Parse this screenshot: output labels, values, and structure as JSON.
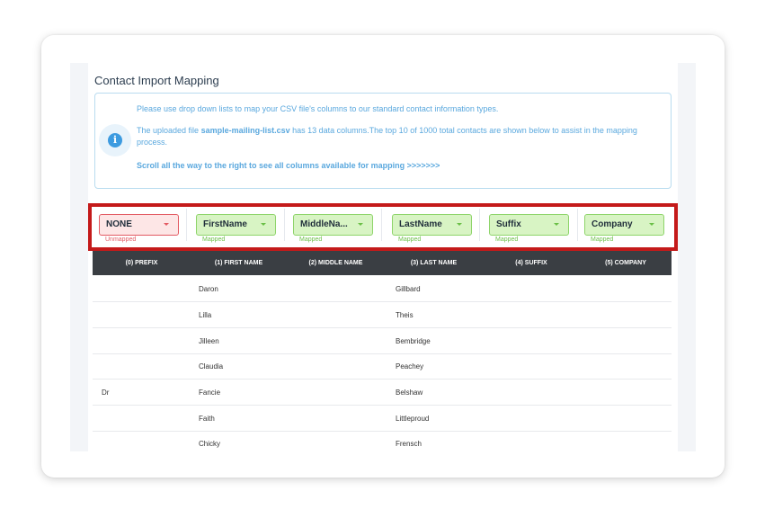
{
  "page": {
    "title": "Contact Import Mapping"
  },
  "info": {
    "line1": "Please use drop down lists to map your CSV file's columns to our standard contact information types.",
    "line2_prefix": "The uploaded file ",
    "line2_file": "sample-mailing-list.csv",
    "line2_suffix": " has 13 data columns.The top 10 of 1000 total contacts are shown below to assist in the mapping process.",
    "line3": "Scroll all the way to the right to see all columns available for mapping >>>>>>>",
    "icon": "info-icon"
  },
  "mappings": [
    {
      "value": "NONE",
      "status": "Unmapped",
      "state": "unmapped"
    },
    {
      "value": "FirstName",
      "status": "Mapped",
      "state": "mapped"
    },
    {
      "value": "MiddleNa...",
      "status": "Mapped",
      "state": "mapped"
    },
    {
      "value": "LastName",
      "status": "Mapped",
      "state": "mapped"
    },
    {
      "value": "Suffix",
      "status": "Mapped",
      "state": "mapped"
    },
    {
      "value": "Company",
      "status": "Mapped",
      "state": "mapped"
    }
  ],
  "table": {
    "headers": [
      "(0) PREFIX",
      "(1) FIRST NAME",
      "(2) MIDDLE NAME",
      "(3) LAST NAME",
      "(4) SUFFIX",
      "(5) COMPANY"
    ],
    "rows": [
      [
        "",
        "Daron",
        "",
        "Gillbard",
        "",
        ""
      ],
      [
        "",
        "Lilla",
        "",
        "Theis",
        "",
        ""
      ],
      [
        "",
        "Jilleen",
        "",
        "Bembridge",
        "",
        ""
      ],
      [
        "",
        "Claudia",
        "",
        "Peachey",
        "",
        ""
      ],
      [
        "Dr",
        "Fancie",
        "",
        "Belshaw",
        "",
        ""
      ],
      [
        "",
        "Faith",
        "",
        "Littleproud",
        "",
        ""
      ],
      [
        "",
        "Chicky",
        "",
        "Frensch",
        "",
        ""
      ]
    ]
  },
  "colors": {
    "highlight_frame": "#c41a1a",
    "mapped": "#6bbf47",
    "unmapped": "#e35b63",
    "header_bg": "#3a3e43",
    "info_text": "#5aa8de"
  }
}
